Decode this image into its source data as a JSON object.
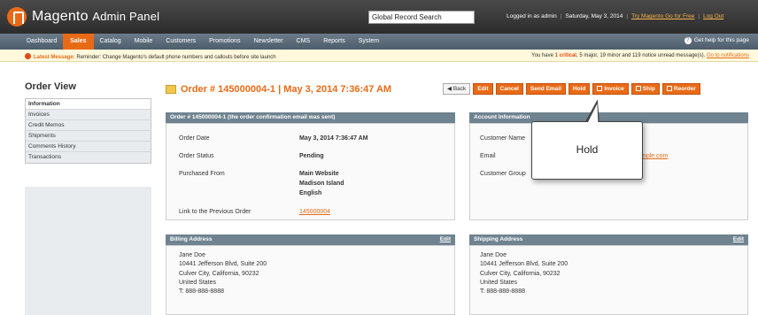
{
  "header": {
    "logo_main": "Magento",
    "logo_sub": "Admin Panel",
    "search_value": "Global Record Search",
    "logged_in": "Logged in as admin",
    "date": "Saturday, May 3, 2014",
    "try_link": "Try Magento Go for Free",
    "logout": "Log Out"
  },
  "nav": {
    "items": [
      "Dashboard",
      "Sales",
      "Catalog",
      "Mobile",
      "Customers",
      "Promotions",
      "Newsletter",
      "CMS",
      "Reports",
      "System"
    ],
    "active": "Sales",
    "help": "Get help for this page"
  },
  "message": {
    "label": "Latest Message:",
    "text": "Reminder: Change Magento's default phone numbers and callouts before site launch",
    "right_prefix": "You have",
    "critical": "1 critical",
    "right_rest": ", 5 major, 19 minor and 119 notice unread message(s).",
    "link": "Go to notifications"
  },
  "sidebar": {
    "title": "Order View",
    "tabs": [
      "Information",
      "Invoices",
      "Credit Memos",
      "Shipments",
      "Comments History",
      "Transactions"
    ]
  },
  "order": {
    "title": "Order # 145000004-1 | May 3, 2014 7:36:47 AM"
  },
  "actions": {
    "back": "Back",
    "edit": "Edit",
    "cancel": "Cancel",
    "send_email": "Send Email",
    "hold": "Hold",
    "invoice": "Invoice",
    "ship": "Ship",
    "reorder": "Reorder"
  },
  "order_box": {
    "header": "Order # 145000004-1 (the order confirmation email was sent)",
    "labels": [
      "Order Date",
      "Order Status",
      "Purchased From",
      "Link to the Previous Order"
    ],
    "order_date": "May 3, 2014 7:36:47 AM",
    "order_status": "Pending",
    "purchased_from": [
      "Main Website",
      "Madison Island",
      "English"
    ],
    "previous_order": "145000004"
  },
  "account_box": {
    "header": "Account Information",
    "labels": [
      "Customer Name",
      "Email",
      "Customer Group"
    ],
    "email_partial": "mple.com"
  },
  "billing": {
    "header": "Billing Address",
    "edit": "Edit",
    "lines": [
      "Jane Doe",
      "10441 Jefferson Blvd, Suite 200",
      "Culver City, California, 90232",
      "United States",
      "T: 888-888-8888"
    ]
  },
  "shipping": {
    "header": "Shipping Address",
    "edit": "Edit",
    "lines": [
      "Jane Doe",
      "10441 Jefferson Blvd, Suite 200",
      "Culver City, California, 90232",
      "United States",
      "T: 888-888-8888"
    ]
  },
  "callout": {
    "text": "Hold"
  }
}
